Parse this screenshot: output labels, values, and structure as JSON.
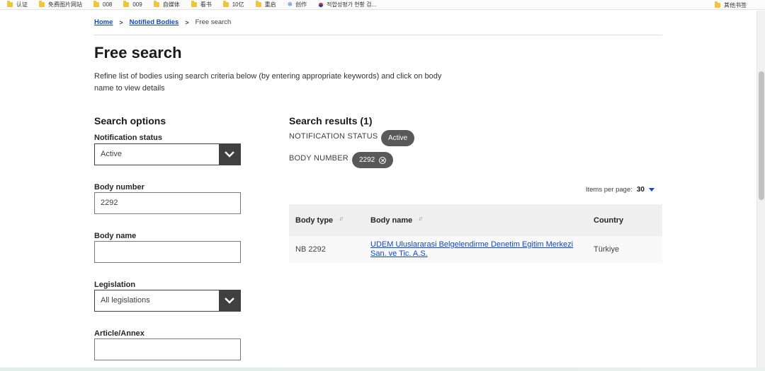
{
  "bookmarks": {
    "items": [
      {
        "label": "认证",
        "icon": "folder-icon"
      },
      {
        "label": "免费图片网站",
        "icon": "folder-icon"
      },
      {
        "label": "008",
        "icon": "folder-icon"
      },
      {
        "label": "009",
        "icon": "folder-icon"
      },
      {
        "label": "自媒体",
        "icon": "folder-icon"
      },
      {
        "label": "看书",
        "icon": "folder-icon"
      },
      {
        "label": "10亿",
        "icon": "folder-icon"
      },
      {
        "label": "重启",
        "icon": "folder-icon"
      },
      {
        "label": "创作",
        "icon": "snowflake-icon"
      },
      {
        "label": "적합성평가 현황 검...",
        "icon": "korea-flag-icon"
      }
    ],
    "other_label": "其他书签"
  },
  "breadcrumb": {
    "home": "Home",
    "section": "Notified Bodies",
    "current": "Free search"
  },
  "page": {
    "title": "Free search",
    "intro": "Refine list of bodies using search criteria below (by entering appropriate keywords) and click on body name to view details"
  },
  "search_options": {
    "title": "Search options",
    "notification_status": {
      "label": "Notification status",
      "value": "Active"
    },
    "body_number": {
      "label": "Body number",
      "value": "2292"
    },
    "body_name": {
      "label": "Body name",
      "value": ""
    },
    "legislation": {
      "label": "Legislation",
      "value": "All legislations"
    },
    "article_annex": {
      "label": "Article/Annex",
      "value": ""
    }
  },
  "results": {
    "title": "Search results (1)",
    "filters": [
      {
        "label": "NOTIFICATION STATUS",
        "value": "Active"
      },
      {
        "label": "BODY NUMBER",
        "value": "2292"
      }
    ],
    "items_per_page_label": "Items per page:",
    "items_per_page": "30",
    "columns": [
      "Body type",
      "Body name",
      "Country"
    ],
    "rows": [
      {
        "body_type": "NB 2292",
        "body_name_line1": "UDEM Uluslararasi Belgelendirme Denetim Egitim Merkezi",
        "body_name_line2": "San. ve Tic. A.S.",
        "country": "Türkiye"
      }
    ]
  },
  "colors": {
    "link": "#0e47cb",
    "dark_control": "#404040",
    "chip": "#595959",
    "table_header": "#efefef"
  }
}
